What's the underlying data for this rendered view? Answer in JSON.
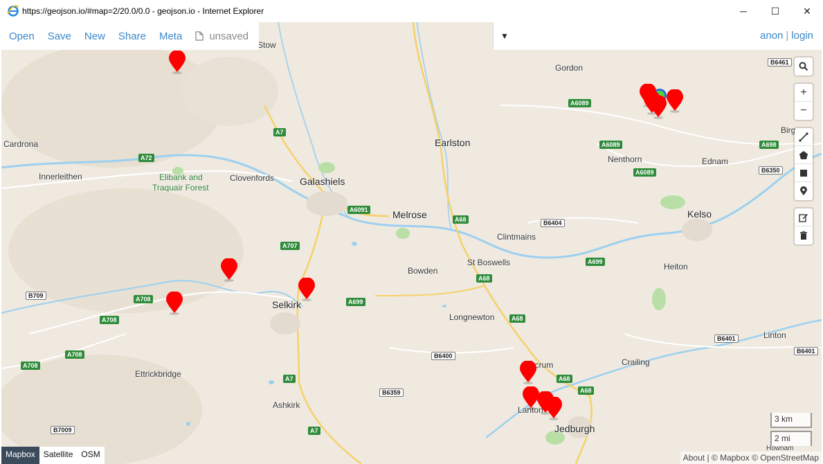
{
  "window": {
    "title": "https://geojson.io/#map=2/20.0/0.0 - geojson.io - Internet Explorer",
    "minimize": "─",
    "maximize": "☐",
    "close": "✕"
  },
  "toolbar": {
    "items": [
      "Open",
      "Save",
      "New",
      "Share",
      "Meta"
    ],
    "file_status": "unsaved"
  },
  "user": {
    "anon": "anon",
    "sep": "|",
    "login": "login"
  },
  "caret": "▼",
  "controls": {
    "search": "⌕",
    "zoom_in": "+",
    "zoom_out": "−"
  },
  "layers": [
    "Mapbox",
    "Satellite",
    "OSM"
  ],
  "scale": {
    "km": "3 km",
    "mi": "2 mi"
  },
  "attribution": "About | © Mapbox © OpenStreetMap",
  "places": {
    "stow": "Stow",
    "gordon": "Gordon",
    "cardrona": "Cardrona",
    "earlston": "Earlston",
    "innerleithen": "Innerleithen",
    "elibank": "Elibank and",
    "traquair": "Traquair Forest",
    "clovenfords": "Clovenfords",
    "galashiels": "Galashiels",
    "melrose": "Melrose",
    "nenthorn": "Nenthorn",
    "ednam": "Ednam",
    "kelso": "Kelso",
    "clintmains": "Clintmains",
    "stboswells": "St Boswells",
    "bowden": "Bowden",
    "heiton": "Heiton",
    "selkirk": "Selkirk",
    "longnewton": "Longnewton",
    "linton": "Linton",
    "ettrickbridge": "Ettrickbridge",
    "crailing": "Crailing",
    "ancrum": "Ancrum",
    "ashkirk": "Ashkirk",
    "lanton": "Lanton",
    "jedburgh": "Jedburgh",
    "birg": "Birg",
    "hownam": "Hownam"
  },
  "roads": {
    "a7_1": "A7",
    "a72": "A72",
    "a6091": "A6091",
    "a68_1": "A68",
    "a707": "A707",
    "a699_1": "A699",
    "a68_2": "A68",
    "a68_3": "A68",
    "a708_1": "A708",
    "a708_2": "A708",
    "a708_3": "A708",
    "a708_4": "A708",
    "a7_2": "A7",
    "a7_3": "A7",
    "a68_4": "A68",
    "a68_5": "A68",
    "a6089_1": "A6089",
    "a6089_2": "A6089",
    "a6089_3": "A6089",
    "a698": "A698",
    "a699_2": "A699",
    "b6461": "B6461",
    "b6350": "B6350",
    "b6404": "B6404",
    "b709": "B709",
    "b6400": "B6400",
    "b6359": "B6359",
    "b7009": "B7009",
    "b6401_1": "B6401",
    "b6401_2": "B6401"
  },
  "colors": {
    "marker": "#ff0000",
    "accent": "#3a87c8",
    "road_green": "#2e8b3a"
  }
}
